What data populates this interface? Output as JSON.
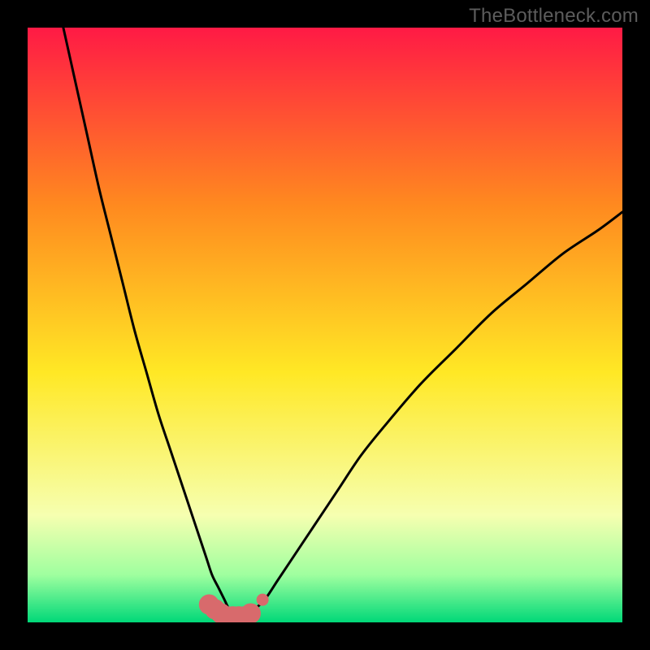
{
  "watermark": "TheBottleneck.com",
  "colors": {
    "frame": "#000000",
    "grad_top": "#ff1a45",
    "grad_mid1": "#ff8a1f",
    "grad_mid2": "#ffe825",
    "grad_low": "#f6ffb0",
    "grad_green_top": "#9fff9f",
    "grad_green_bot": "#00d878",
    "curve": "#000000",
    "marker_fill": "#d86a6c",
    "marker_stroke": "#d86a6c"
  },
  "chart_data": {
    "type": "line",
    "title": "",
    "xlabel": "",
    "ylabel": "",
    "xlim": [
      0,
      100
    ],
    "ylim": [
      0,
      100
    ],
    "series": [
      {
        "name": "bottleneck-curve",
        "x": [
          6,
          8,
          10,
          12,
          14,
          16,
          18,
          20,
          22,
          24,
          26,
          28,
          30,
          31,
          32,
          33,
          34,
          35,
          36,
          37,
          38,
          40,
          42,
          44,
          46,
          48,
          52,
          56,
          60,
          66,
          72,
          78,
          84,
          90,
          96,
          100
        ],
        "values": [
          100,
          91,
          82,
          73,
          65,
          57,
          49,
          42,
          35,
          29,
          23,
          17,
          11,
          8,
          6,
          4,
          2,
          1,
          1,
          1,
          2,
          4,
          7,
          10,
          13,
          16,
          22,
          28,
          33,
          40,
          46,
          52,
          57,
          62,
          66,
          69
        ]
      }
    ],
    "markers": {
      "name": "highlight-points",
      "x": [
        30.5,
        31.5,
        32.5,
        33.5,
        34.5,
        35.5,
        36.5,
        37.5,
        39.5
      ],
      "values": [
        3.0,
        2.2,
        1.5,
        1.0,
        1.0,
        1.0,
        1.0,
        1.5,
        3.8
      ],
      "radius": [
        12,
        12,
        12,
        12,
        12,
        12,
        12,
        12,
        7
      ]
    }
  }
}
